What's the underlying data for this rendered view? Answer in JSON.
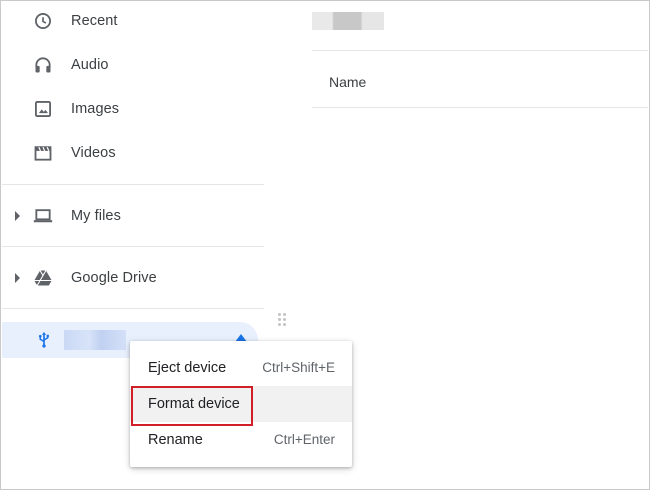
{
  "sidebar": {
    "items": [
      {
        "label": "Recent",
        "icon": "clock-icon"
      },
      {
        "label": "Audio",
        "icon": "headphones-icon"
      },
      {
        "label": "Images",
        "icon": "image-icon"
      },
      {
        "label": "Videos",
        "icon": "video-clapper-icon"
      }
    ],
    "my_files": {
      "label": "My files",
      "icon": "laptop-icon"
    },
    "google_drive": {
      "label": "Google Drive",
      "icon": "google-drive-icon"
    },
    "usb_device": {
      "icon": "usb-icon",
      "eject_icon": "eject-icon"
    }
  },
  "main": {
    "column_header": "Name"
  },
  "context_menu": {
    "items": [
      {
        "label": "Eject device",
        "shortcut": "Ctrl+Shift+E"
      },
      {
        "label": "Format device",
        "shortcut": ""
      },
      {
        "label": "Rename",
        "shortcut": "Ctrl+Enter"
      }
    ],
    "highlighted_item": "Format device"
  },
  "colors": {
    "usb_row_bg": "#e8f0fe",
    "accent_blue": "#1a73e8",
    "highlight_red": "#d11f28",
    "icon_gray": "#5f6368"
  }
}
